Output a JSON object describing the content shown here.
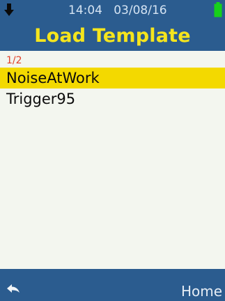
{
  "status_bar": {
    "time": "14:04",
    "date": "03/08/16",
    "download_icon": "arrow-down-icon",
    "battery_icon": "battery-icon",
    "battery_color": "#17d11a"
  },
  "header": {
    "title": "Load Template",
    "title_color": "#f5e51d",
    "background_color": "#2b5c8f"
  },
  "list": {
    "page_indicator": "1/2",
    "items": [
      {
        "label": "NoiseAtWork",
        "selected": true
      },
      {
        "label": "Trigger95",
        "selected": false
      }
    ],
    "selected_color": "#f3d900"
  },
  "footer": {
    "back_icon": "back-arrow-icon",
    "home_label": "Home"
  }
}
